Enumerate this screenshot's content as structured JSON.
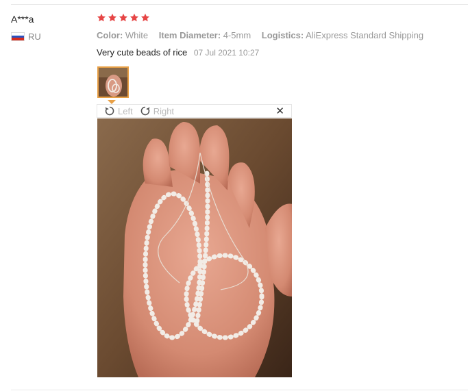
{
  "reviewer": {
    "name": "A***a",
    "country_code": "RU"
  },
  "rating": {
    "stars": 5,
    "max": 5,
    "color": "#e64545"
  },
  "attributes": [
    {
      "key": "Color:",
      "value": "White"
    },
    {
      "key": "Item Diameter:",
      "value": "4-5mm"
    },
    {
      "key": "Logistics:",
      "value": "AliExpress Standard Shipping"
    }
  ],
  "review": {
    "text": "Very cute beads of rice",
    "date": "07 Jul 2021 10:27"
  },
  "viewer": {
    "rotate_left_label": "Left",
    "rotate_right_label": "Right",
    "close_glyph": "✕"
  },
  "colors": {
    "accent": "#e8a046",
    "star": "#e64545"
  }
}
